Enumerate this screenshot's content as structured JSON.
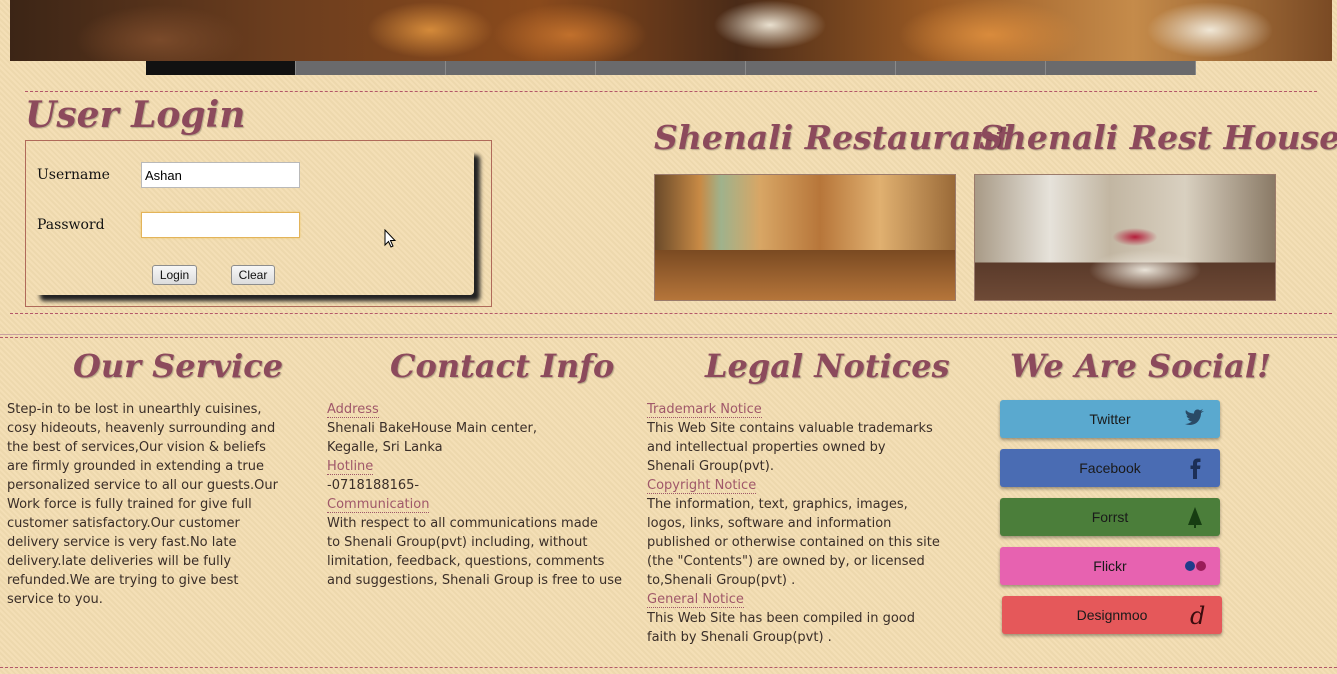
{
  "nav": {
    "items": [
      "",
      "",
      "",
      "",
      "",
      "",
      ""
    ]
  },
  "login": {
    "title": "User Login",
    "username_label": "Username",
    "username_value": "Ashan",
    "password_label": "Password",
    "password_value": "",
    "login_button": "Login",
    "clear_button": "Clear"
  },
  "features": {
    "restaurant_title": "Shenali Restaurant",
    "resthouse_title": "Shenali Rest House"
  },
  "service": {
    "title": "Our Service",
    "lines": [
      "Step-in to be lost in unearthly cuisines,",
      "cosy hideouts, heavenly surrounding and",
      "the best of services,Our vision & beliefs",
      "are firmly grounded in extending a true",
      "personalized service to all our guests.Our",
      "Work force is fully trained for give full",
      "customer satisfactory.Our customer",
      "delivery service is very fast.No late",
      "delivery.late deliveries will be fully",
      "refunded.We are trying to give best",
      "service to you."
    ]
  },
  "contact": {
    "title": "Contact Info",
    "address_label": "Address",
    "address_line1": "Shenali BakeHouse Main center,",
    "address_line2": "Kegalle, Sri Lanka",
    "hotline_label": "Hotline",
    "hotline_value": "-0718188165-",
    "communication_label": "Communication",
    "communication_lines": [
      "With respect to all communications made",
      "to Shenali Group(pvt) including, without",
      "limitation, feedback, questions, comments",
      "and suggestions, Shenali Group is free to use"
    ]
  },
  "legal": {
    "title": "Legal Notices",
    "trademark_label": "Trademark Notice",
    "trademark_lines": [
      "This Web Site contains valuable trademarks",
      "and intellectual properties owned by",
      "Shenali Group(pvt)."
    ],
    "copyright_label": "Copyright Notice",
    "copyright_lines": [
      "The information, text, graphics, images,",
      "logos, links, software and information",
      "published or otherwise contained on this site",
      "(the \"Contents\") are owned by, or licensed",
      "to,Shenali Group(pvt) ."
    ],
    "general_label": "General Notice",
    "general_lines": [
      "This Web Site has been compiled in good",
      "faith by Shenali Group(pvt) ."
    ]
  },
  "social": {
    "title": "We Are Social!",
    "buttons": [
      {
        "label": "Twitter",
        "color": "#5aa9cf",
        "icon": "twitter-icon"
      },
      {
        "label": "Facebook",
        "color": "#4a6cb3",
        "icon": "facebook-icon"
      },
      {
        "label": "Forrst",
        "color": "#4b7e3a",
        "icon": "forrst-icon"
      },
      {
        "label": "Flickr",
        "color": "#e762b0",
        "icon": "flickr-icon"
      },
      {
        "label": "Designmoo",
        "color": "#e5585a",
        "icon": "designmoo-icon"
      }
    ]
  },
  "colors": {
    "accent": "#8c4a5c",
    "background": "#f3ddb1",
    "link": "#a0586a"
  }
}
